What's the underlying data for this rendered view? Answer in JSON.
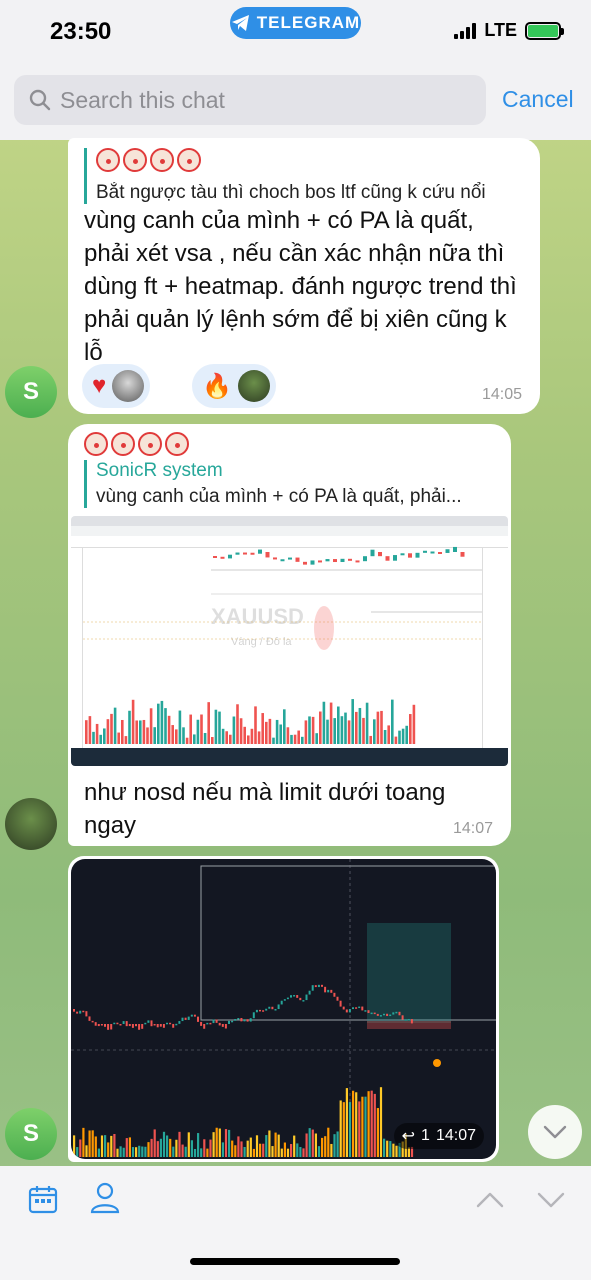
{
  "status_bar": {
    "time": "23:50",
    "network": "LTE"
  },
  "app_pill": "TELEGRAM",
  "search": {
    "placeholder": "Search this chat",
    "cancel_label": "Cancel"
  },
  "messages": [
    {
      "reply_preview": "Bắt ngược tàu thì choch bos ltf cũng k cứu nổi",
      "text": "vùng canh của mình + có PA là quất, phải xét vsa , nếu cần xác nhận nữa thì dùng ft + heatmap. đánh ngược trend thì phải quản lý lệnh sớm để bị xiên cũng k lỗ",
      "time": "14:05",
      "sender_initial": "S"
    },
    {
      "reply_name": "SonicR system",
      "reply_preview": "vùng canh của mình + có PA là quất, phải...",
      "image_watermark": "XAUUSD",
      "image_sub": "Vàng / Đô la",
      "text": "như nosd nếu mà limit dưới toang ngay",
      "time": "14:07"
    },
    {
      "video_count": "1",
      "time": "14:07",
      "sender_initial": "S"
    }
  ],
  "colors": {
    "accent": "#2f8fe6",
    "reply_line": "#27a79a",
    "up": "#26a69a",
    "down": "#ef5350"
  }
}
